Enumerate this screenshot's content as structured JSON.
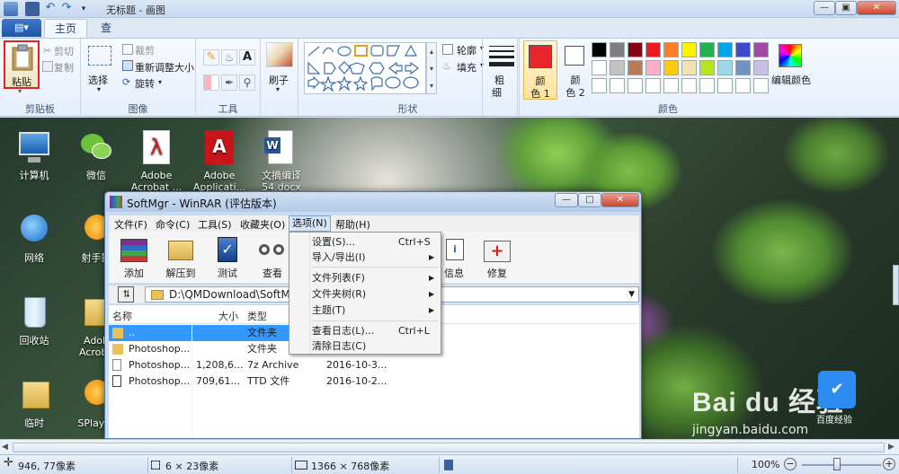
{
  "window": {
    "title": "无标题 - 画图"
  },
  "tabs": {
    "file_menu": "▤▾",
    "home": "主页",
    "view": "查看"
  },
  "ribbon": {
    "clipboard": {
      "paste": "粘贴",
      "cut": "剪切",
      "copy": "复制",
      "label": "剪贴板"
    },
    "image": {
      "select": "选择",
      "crop": "裁剪",
      "resize": "重新调整大小",
      "rotate": "旋转",
      "label": "图像"
    },
    "tools": {
      "label": "工具",
      "text_tool": "A"
    },
    "brushes": {
      "label": "刷子"
    },
    "shapes": {
      "outline": "轮廓",
      "fill": "填充",
      "label": "形状"
    },
    "size": {
      "label1": "粗",
      "label2": "细"
    },
    "colors": {
      "color1_l1": "颜",
      "color1_l2": "色 1",
      "color2_l1": "颜",
      "color2_l2": "色 2",
      "edit": "编辑颜色",
      "label": "颜色",
      "accent_color1": "#e8252c",
      "palette_row1": [
        "#000000",
        "#7f7f7f",
        "#880015",
        "#ed1c24",
        "#ff7f27",
        "#fff200",
        "#22b14c",
        "#00a2e8",
        "#3f48cc",
        "#a349a4"
      ],
      "palette_row2": [
        "#ffffff",
        "#c3c3c3",
        "#b97a57",
        "#ffaec9",
        "#ffc90e",
        "#efe4b0",
        "#b5e61d",
        "#99d9ea",
        "#7092be",
        "#c8bfe7"
      ]
    }
  },
  "desktop": {
    "icons": [
      {
        "label": "计算机"
      },
      {
        "label": "微信"
      },
      {
        "label": "Adobe Acrobat ..."
      },
      {
        "label": "Adobe Applicati..."
      },
      {
        "label": "文摘编译 54.docx"
      },
      {
        "label": "网络"
      },
      {
        "label": "射手影"
      },
      {
        "label": "回收站"
      },
      {
        "label": "Adob Acroba"
      },
      {
        "label": "临时"
      },
      {
        "label": "SPlayer"
      }
    ]
  },
  "winrar": {
    "title": "SoftMgr - WinRAR (评估版本)",
    "menus": [
      "文件(F)",
      "命令(C)",
      "工具(S)",
      "收藏夹(O)",
      "选项(N)",
      "帮助(H)"
    ],
    "toolbar": [
      "添加",
      "解压到",
      "测试",
      "查看",
      "信息",
      "修复"
    ],
    "path": "D:\\QMDownload\\SoftMgr",
    "columns": {
      "name": "名称",
      "size": "大小",
      "type": "类型"
    },
    "rows": [
      {
        "name": "..",
        "size": "",
        "type": "文件夹",
        "modified": ""
      },
      {
        "name": "Photoshop...",
        "size": "",
        "type": "文件夹",
        "modified": ""
      },
      {
        "name": "Photoshop...",
        "size": "1,208,6...",
        "type": "7z Archive",
        "modified": "2016-10-3..."
      },
      {
        "name": "Photoshop...",
        "size": "709,61...",
        "type": "TTD 文件",
        "modified": "2016-10-2..."
      }
    ]
  },
  "options_menu": {
    "items": [
      {
        "label": "设置(S)...",
        "shortcut": "Ctrl+S",
        "arrow": ""
      },
      {
        "label": "导入/导出(I)",
        "shortcut": "",
        "arrow": "▶"
      },
      {
        "label": "文件列表(F)",
        "shortcut": "",
        "arrow": "▶"
      },
      {
        "label": "文件夹树(R)",
        "shortcut": "",
        "arrow": "▶"
      },
      {
        "label": "主题(T)",
        "shortcut": "",
        "arrow": "▶"
      },
      {
        "label": "查看日志(L)...",
        "shortcut": "Ctrl+L",
        "arrow": ""
      },
      {
        "label": "清除日志(C)",
        "shortcut": "",
        "arrow": ""
      }
    ]
  },
  "status": {
    "cursor": "946, 77像素",
    "selection": "6 × 23像素",
    "canvas": "1366 × 768像素",
    "zoom": "100%"
  },
  "watermark": {
    "brand": "Bai du 经验",
    "url": "jingyan.baidu.com",
    "small": "百度经验"
  }
}
